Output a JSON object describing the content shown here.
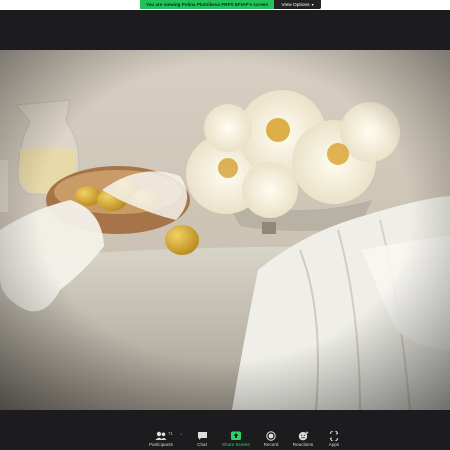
{
  "banner": {
    "text": "You are viewing Polina Plotnikova FRPS EFIAP's screen",
    "view_options": "View Options"
  },
  "toolbar": {
    "participants_label": "Participants",
    "participants_count": "71",
    "chat_label": "Chat",
    "share_screen_label": "Share Screen",
    "record_label": "Record",
    "reactions_label": "Reactions",
    "apps_label": "Apps"
  },
  "icons": {
    "participants": "people-icon",
    "chat": "chat-bubble-icon",
    "share_screen": "share-arrow-icon",
    "record": "record-dot-icon",
    "reactions": "smile-plus-icon",
    "apps": "apps-icon"
  },
  "colors": {
    "share_banner": "#23c35b",
    "toolbar_bg": "#1c1c1e",
    "share_screen_accent": "#2bd466"
  }
}
